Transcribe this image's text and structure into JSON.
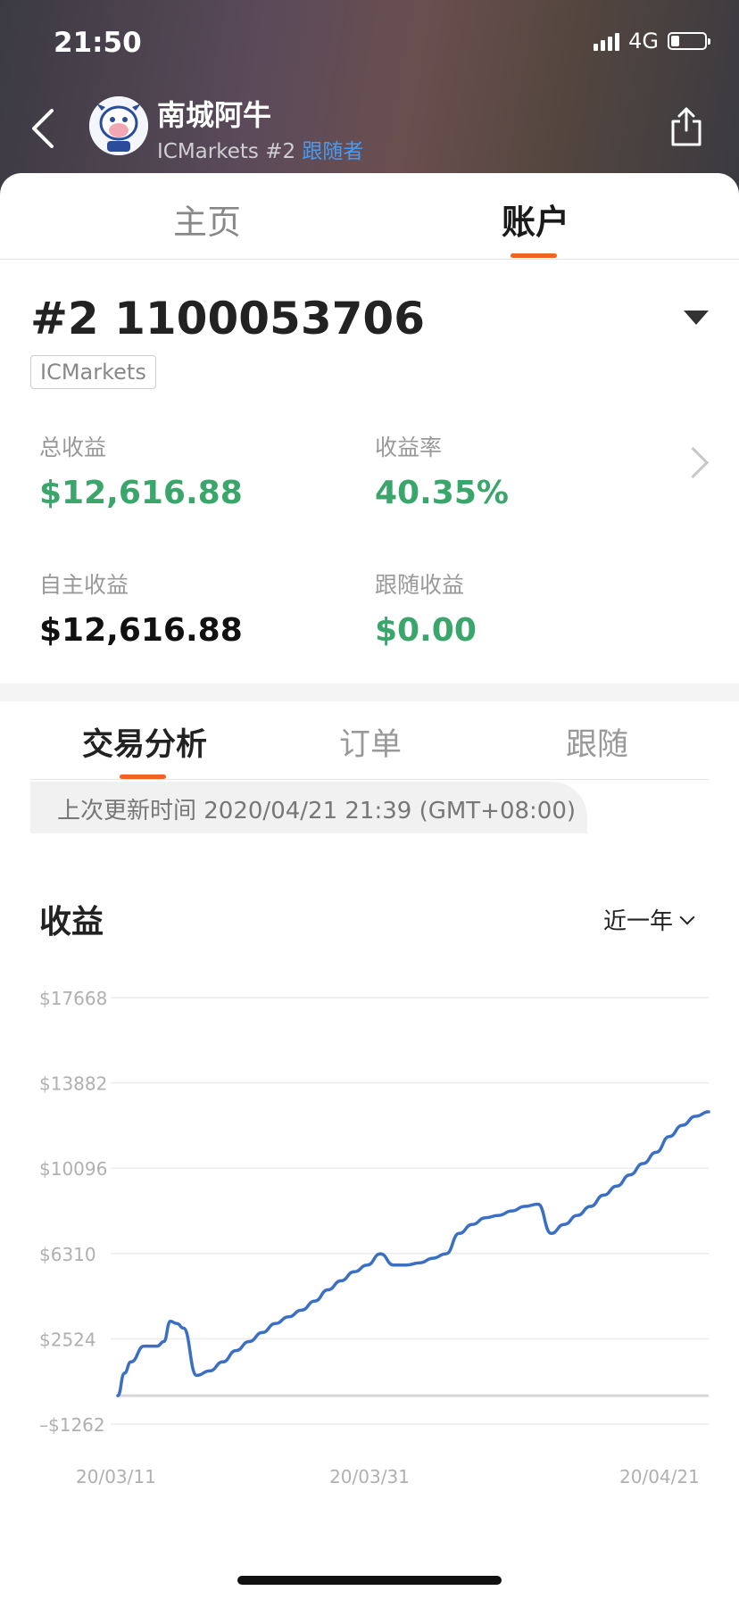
{
  "status_bar": {
    "time": "21:50",
    "network": "4G",
    "battery_level": 0.25
  },
  "header": {
    "user_name": "南城阿牛",
    "broker_rank": "ICMarkets #2",
    "follower_label": "跟随者"
  },
  "top_tabs": [
    {
      "label": "主页",
      "active": false
    },
    {
      "label": "账户",
      "active": true
    }
  ],
  "account": {
    "title": "#2 1100053706",
    "broker": "ICMarkets",
    "stats": {
      "total_profit": {
        "label": "总收益",
        "value": "$12,616.88"
      },
      "return_rate": {
        "label": "收益率",
        "value": "40.35%"
      },
      "own_profit": {
        "label": "自主收益",
        "value": "$12,616.88"
      },
      "follow_profit": {
        "label": "跟随收益",
        "value": "$0.00"
      }
    }
  },
  "sub_tabs": [
    {
      "label": "交易分析",
      "active": true
    },
    {
      "label": "订单",
      "active": false
    },
    {
      "label": "跟随",
      "active": false
    }
  ],
  "update_time": "上次更新时间 2020/04/21 21:39 (GMT+08:00)",
  "chart_section": {
    "title": "收益",
    "range": "近一年"
  },
  "colors": {
    "accent": "#f06420",
    "profit_green": "#3aa66b",
    "line": "#3b6fc4",
    "follower": "#4a9af0"
  },
  "chart_data": {
    "type": "line",
    "title": "收益",
    "xlabel": "",
    "ylabel": "",
    "ylim": [
      -1262,
      17668
    ],
    "yticks": [
      17668,
      13882,
      10096,
      6310,
      2524,
      -1262
    ],
    "ytick_labels": [
      "$17668",
      "$13882",
      "$10096",
      "$6310",
      "$2524",
      "–$1262"
    ],
    "xtick_labels": [
      "20/03/11",
      "20/03/31",
      "20/04/21"
    ],
    "grid": true,
    "series": [
      {
        "x": [
          0,
          0.5,
          1,
          2,
          3,
          3.5,
          4,
          4.5,
          5,
          6,
          7,
          8,
          9,
          10,
          11,
          12,
          13,
          14,
          15,
          16,
          17,
          18,
          19,
          20,
          21,
          22,
          23,
          24,
          25,
          26,
          27,
          28,
          29,
          30,
          31,
          32,
          33,
          34,
          35,
          36,
          37,
          38,
          39,
          40,
          41,
          42,
          43,
          44,
          45
        ],
        "y": [
          0,
          1000,
          1500,
          2200,
          2200,
          2400,
          3300,
          3200,
          3000,
          900,
          1100,
          1500,
          2000,
          2400,
          2800,
          3200,
          3500,
          3800,
          4200,
          4700,
          5100,
          5500,
          5800,
          6300,
          5800,
          5800,
          5900,
          6100,
          6300,
          7200,
          7600,
          7900,
          8000,
          8200,
          8400,
          8500,
          7200,
          7600,
          8000,
          8400,
          8900,
          9300,
          9800,
          10300,
          10800,
          11500,
          12000,
          12400,
          12600
        ]
      }
    ]
  }
}
